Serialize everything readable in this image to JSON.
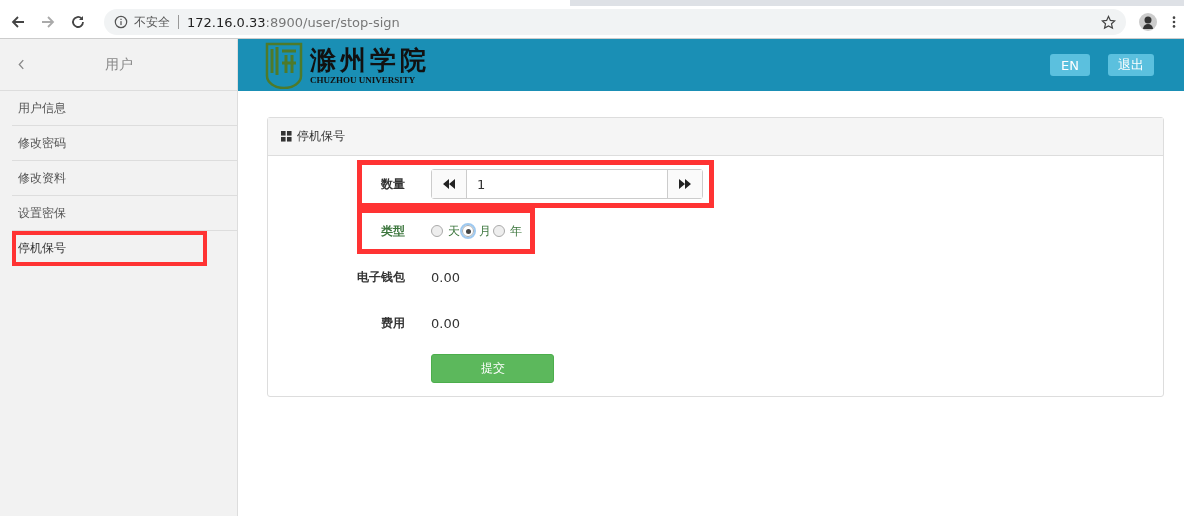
{
  "browser": {
    "security": "不安全",
    "host": "172.16.0.33",
    "path": ":8900/user/stop-sign"
  },
  "sidebar": {
    "title": "用户",
    "items": [
      {
        "label": "用户信息",
        "selected": false,
        "highlighted": false
      },
      {
        "label": "修改密码",
        "selected": false,
        "highlighted": false
      },
      {
        "label": "修改资料",
        "selected": false,
        "highlighted": false
      },
      {
        "label": "设置密保",
        "selected": false,
        "highlighted": false
      },
      {
        "label": "停机保号",
        "selected": true,
        "highlighted": true
      }
    ]
  },
  "header": {
    "logo_name": "滁州学院",
    "logo_subtitle": "CHUZHOU UNIVERSITY",
    "buttons": [
      "EN",
      "退出"
    ]
  },
  "panel": {
    "title": "停机保号",
    "rows": [
      {
        "kind": "stepper",
        "label": "数量",
        "value": "1",
        "highlighted": true
      },
      {
        "kind": "radio",
        "label": "类型",
        "highlighted": true,
        "options": [
          {
            "label": "天",
            "selected": false
          },
          {
            "label": "月",
            "selected": true
          },
          {
            "label": "年",
            "selected": false
          }
        ]
      },
      {
        "kind": "text",
        "label": "电子钱包",
        "value": "0.00",
        "highlighted": false
      },
      {
        "kind": "text",
        "label": "费用",
        "value": "0.00",
        "highlighted": false
      }
    ],
    "submit": "提交"
  }
}
